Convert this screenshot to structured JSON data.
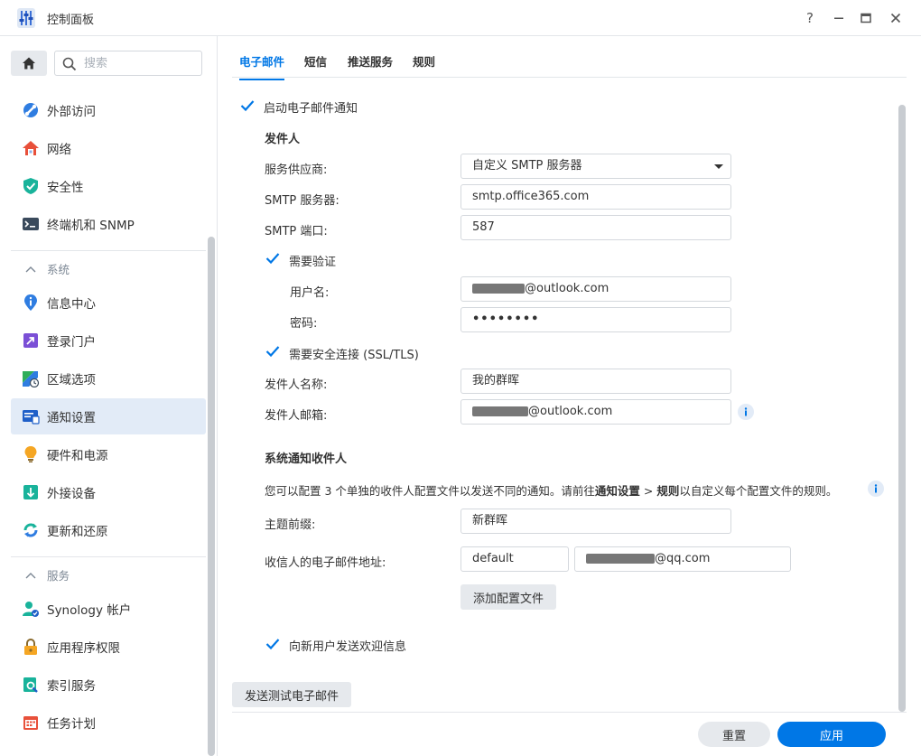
{
  "window": {
    "title": "控制面板",
    "help": "?",
    "minimize": "–",
    "maximize": "▭",
    "close": "✕"
  },
  "sidebar": {
    "search_placeholder": "搜索",
    "top_items": [
      {
        "label": "外部访问",
        "icon": "external-access-icon"
      },
      {
        "label": "网络",
        "icon": "network-icon"
      },
      {
        "label": "安全性",
        "icon": "security-shield-icon"
      },
      {
        "label": "终端机和 SNMP",
        "icon": "terminal-icon"
      }
    ],
    "sections": [
      {
        "label": "系统",
        "items": [
          {
            "label": "信息中心",
            "icon": "info-center-icon"
          },
          {
            "label": "登录门户",
            "icon": "login-portal-icon"
          },
          {
            "label": "区域选项",
            "icon": "region-options-icon"
          },
          {
            "label": "通知设置",
            "icon": "notification-icon",
            "active": true
          },
          {
            "label": "硬件和电源",
            "icon": "hardware-power-icon"
          },
          {
            "label": "外接设备",
            "icon": "external-devices-icon"
          },
          {
            "label": "更新和还原",
            "icon": "update-restore-icon"
          }
        ]
      },
      {
        "label": "服务",
        "items": [
          {
            "label": "Synology 帐户",
            "icon": "synology-account-icon"
          },
          {
            "label": "应用程序权限",
            "icon": "app-privileges-icon"
          },
          {
            "label": "索引服务",
            "icon": "indexing-icon"
          },
          {
            "label": "任务计划",
            "icon": "task-scheduler-icon"
          }
        ]
      }
    ]
  },
  "tabs": [
    {
      "label": "电子邮件",
      "active": true
    },
    {
      "label": "短信"
    },
    {
      "label": "推送服务"
    },
    {
      "label": "规则"
    }
  ],
  "email": {
    "enable_label": "启动电子邮件通知",
    "sender_title": "发件人",
    "provider_label": "服务供应商:",
    "provider_value": "自定义 SMTP 服务器",
    "smtp_server_label": "SMTP 服务器:",
    "smtp_server_value": "smtp.office365.com",
    "smtp_port_label": "SMTP 端口:",
    "smtp_port_value": "587",
    "auth_label": "需要验证",
    "username_label": "用户名:",
    "username_suffix": "@outlook.com",
    "password_label": "密码:",
    "password_value": "••••••••",
    "ssl_label": "需要安全连接 (SSL/TLS)",
    "sender_name_label": "发件人名称:",
    "sender_name_value": "我的群晖",
    "sender_email_label": "发件人邮箱:",
    "sender_email_suffix": "@outlook.com",
    "recipients_title": "系统通知收件人",
    "recipients_desc_1": "您可以配置 3 个单独的收件人配置文件以发送不同的通知。请前往",
    "recipients_desc_link1": "通知设置",
    "recipients_desc_sep": " > ",
    "recipients_desc_link2": "规则",
    "recipients_desc_2": "以自定义每个配置文件的规则。",
    "subject_prefix_label": "主题前缀:",
    "subject_prefix_value": "新群晖",
    "recipient_address_label": "收信人的电子邮件地址:",
    "recipient_profile_value": "default",
    "recipient_email_suffix": "@qq.com",
    "add_profile_label": "添加配置文件",
    "welcome_label": "向新用户发送欢迎信息",
    "send_test_label": "发送测试电子邮件"
  },
  "footer": {
    "reset_label": "重置",
    "apply_label": "应用"
  },
  "colors": {
    "accent": "#0077e6",
    "active_bg": "#e2ebf7"
  }
}
